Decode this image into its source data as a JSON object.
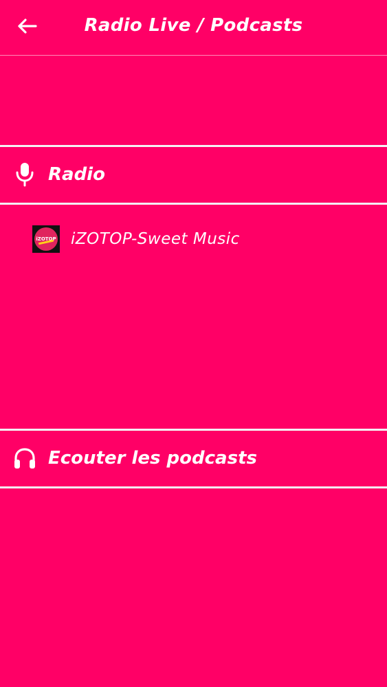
{
  "app_bar": {
    "back_icon": "arrow-left-icon",
    "title": "Radio Live / Podcasts"
  },
  "radio_section": {
    "icon": "microphone-icon",
    "label": "Radio"
  },
  "stations": [
    {
      "name": "iZOTOP-Sweet Music",
      "logo_text": "iZOTOP"
    }
  ],
  "podcasts_section": {
    "icon": "headphones-icon",
    "label": "Ecouter les podcasts"
  },
  "colors": {
    "background": "#ff0066",
    "divider": "#f4f4f4",
    "text": "#ffffff"
  }
}
